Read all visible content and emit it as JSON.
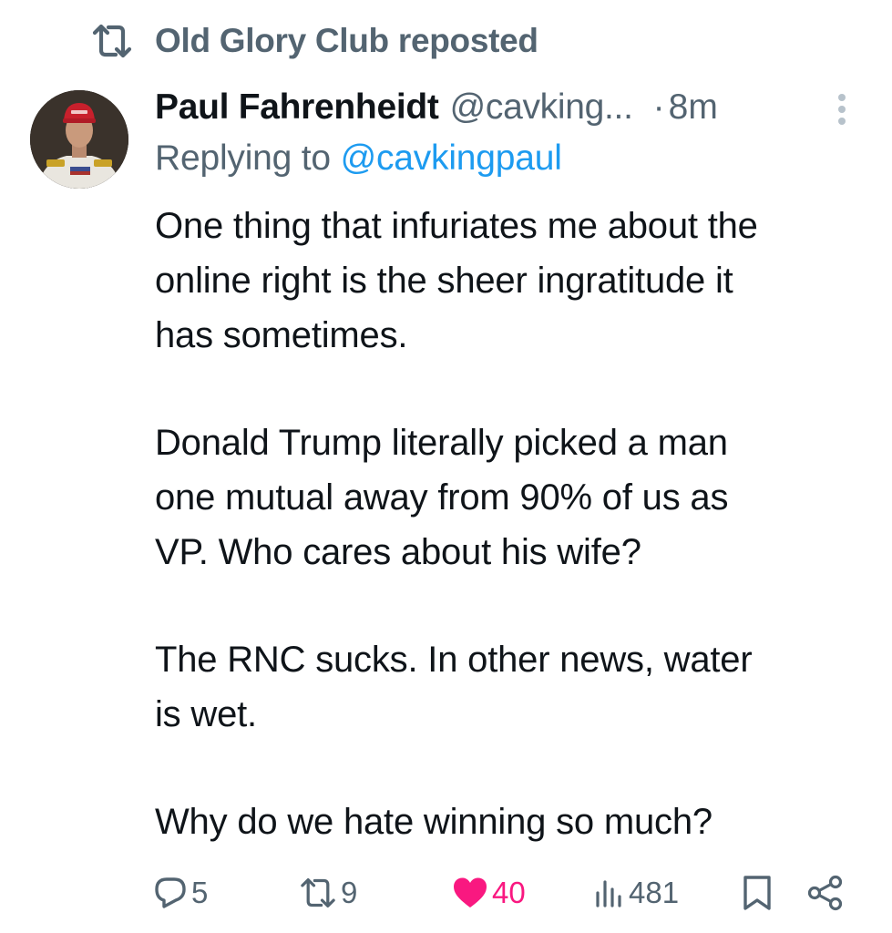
{
  "repost_header": {
    "label": "Old Glory Club reposted"
  },
  "author": {
    "display_name": "Paul Fahrenheidt",
    "handle": "@cavking...",
    "separator": "·",
    "time": "8m"
  },
  "reply_to": {
    "prefix": "Replying to ",
    "mention": "@cavkingpaul"
  },
  "tweet": {
    "lines": [
      "One thing that infuriates me about the",
      "online right is the sheer ingratitude it",
      "has sometimes.",
      "",
      "Donald Trump literally picked a man",
      "one mutual away from 90% of us as",
      "VP. Who cares about his wife?",
      "",
      "The RNC sucks. In other news, water",
      "is wet.",
      "",
      "Why do we hate winning so much?"
    ]
  },
  "actions": {
    "reply_count": "5",
    "repost_count": "9",
    "like_count": "40",
    "views_count": "481",
    "liked": true
  },
  "icons": {
    "repost_header": "repost-icon",
    "more": "more-vertical-icon",
    "reply": "reply-icon",
    "repost": "repost-icon",
    "like": "heart-filled-icon",
    "views": "views-icon",
    "bookmark": "bookmark-icon",
    "share": "share-icon"
  },
  "colors": {
    "text_primary": "#0f1419",
    "text_secondary": "#536471",
    "link": "#1d9bf0",
    "like": "#f91880",
    "avatar_hat": "#c8202c"
  }
}
